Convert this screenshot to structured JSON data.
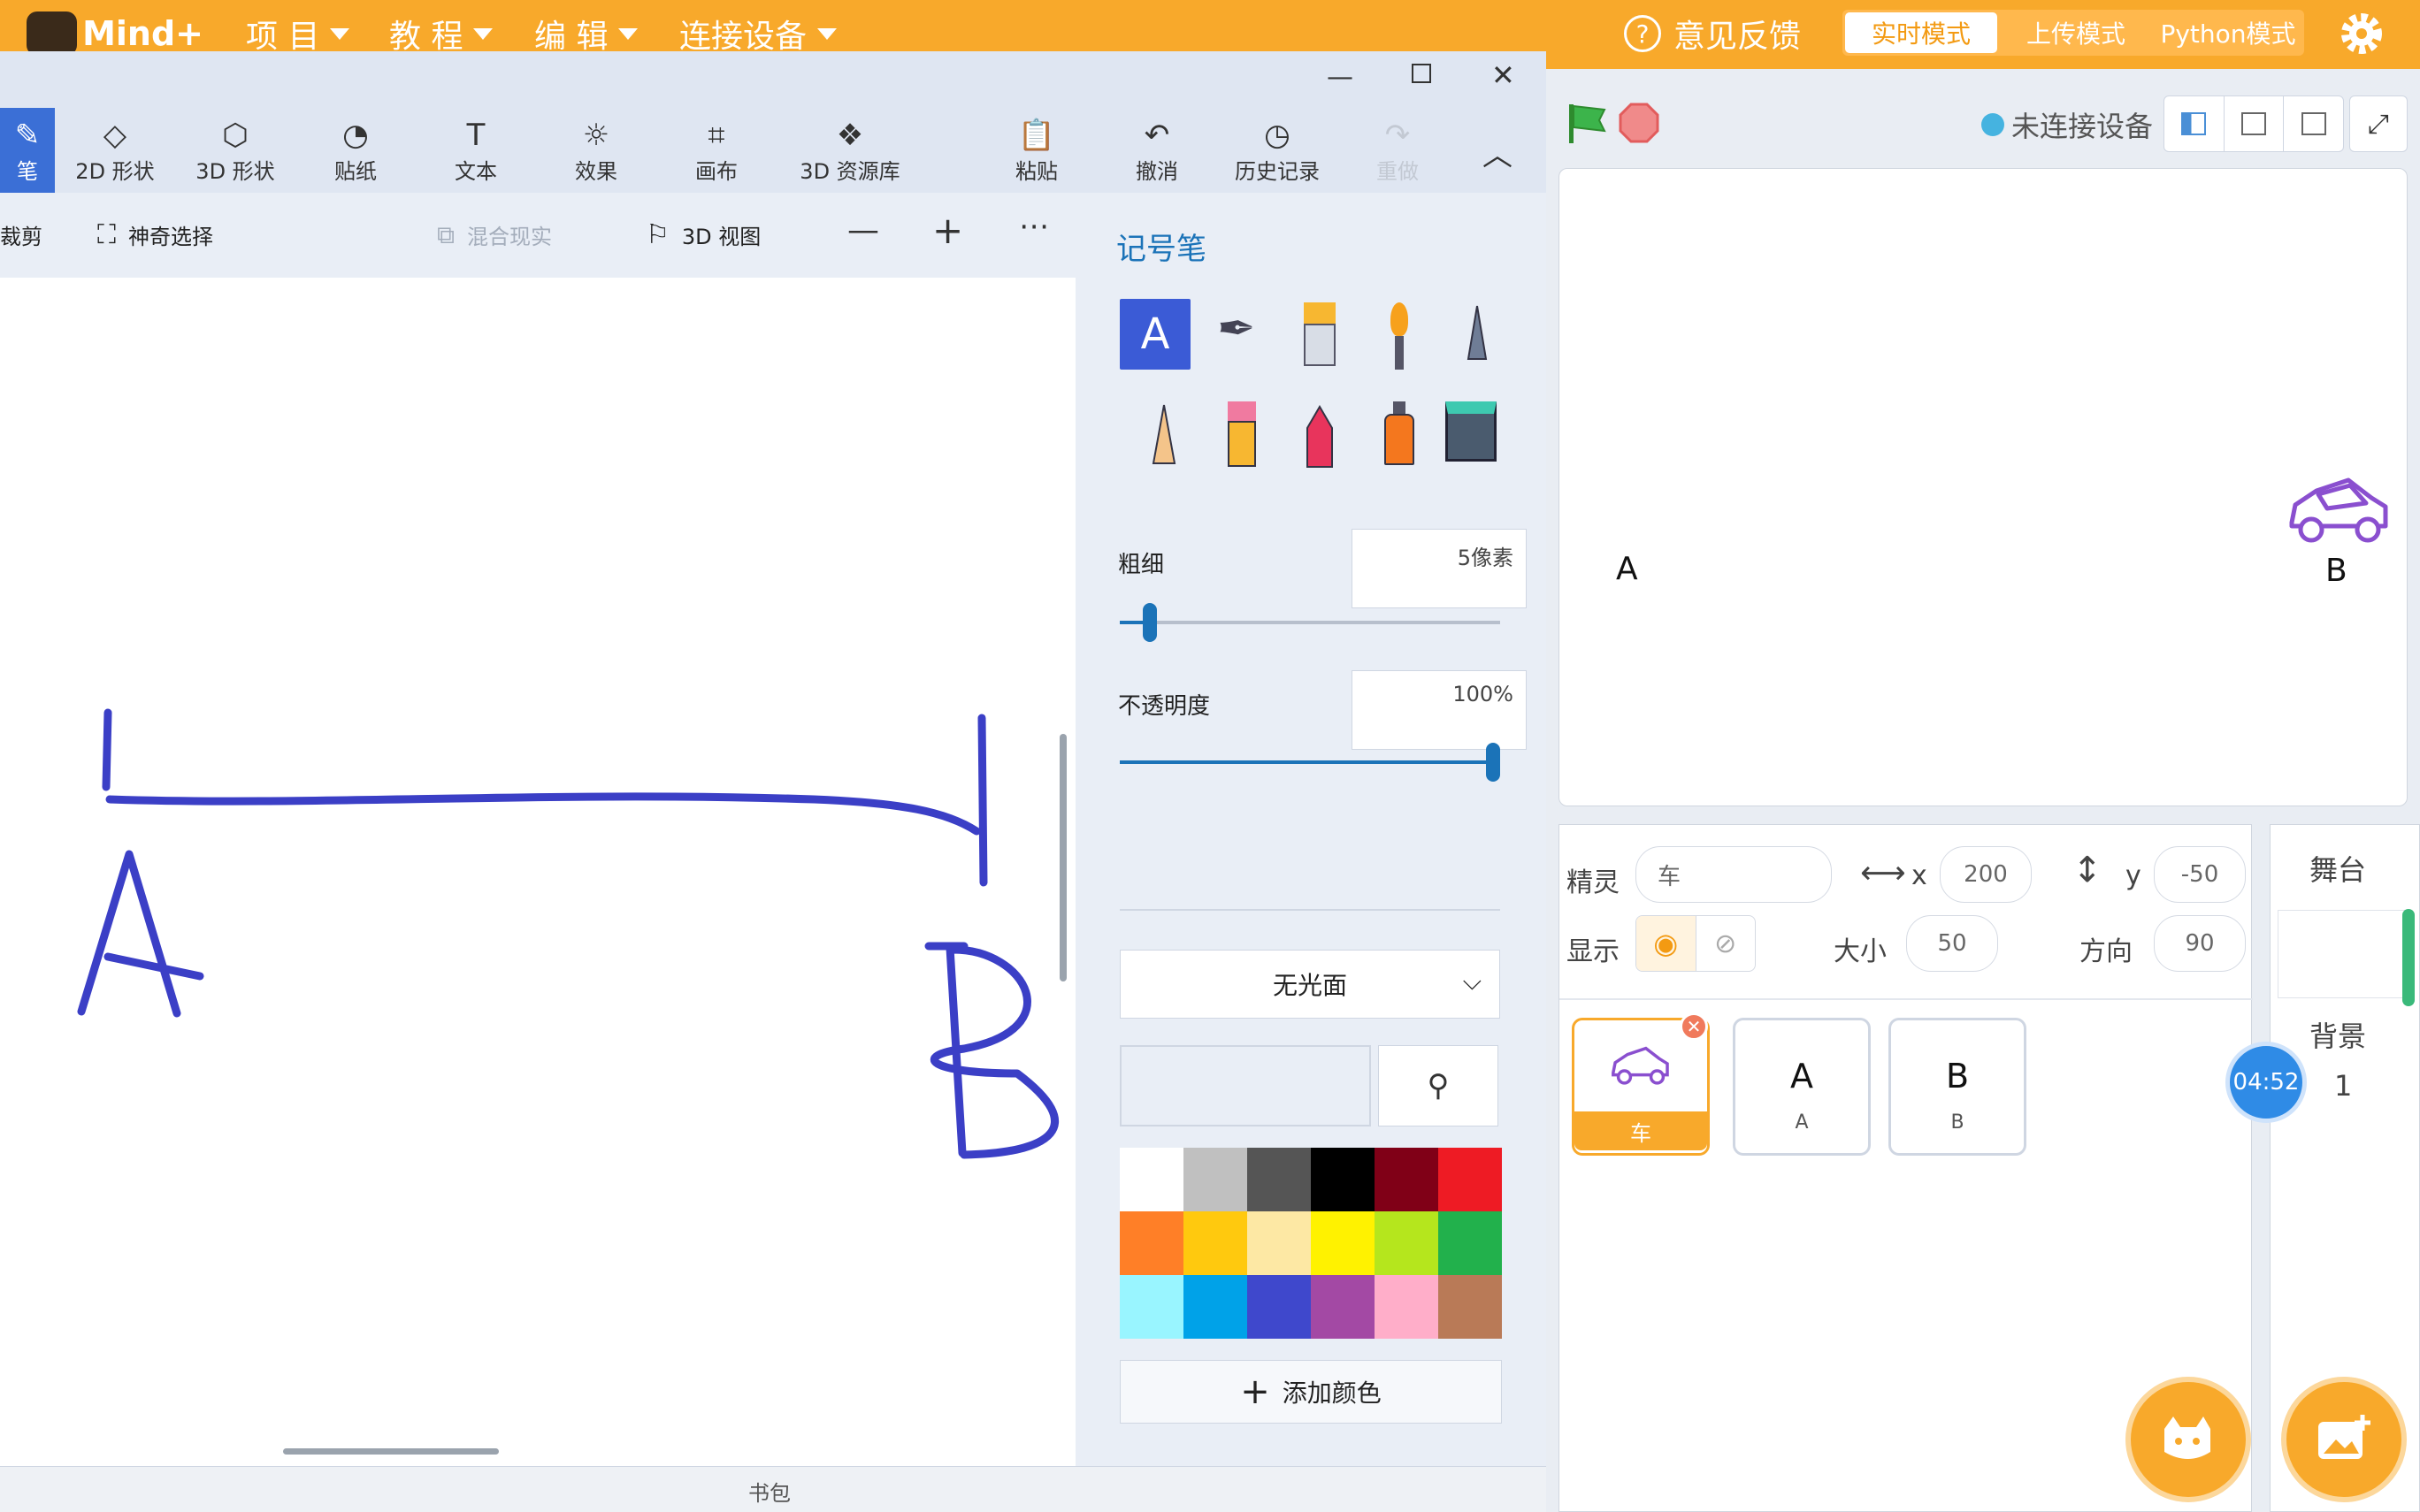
{
  "top": {
    "logo": "Mind+",
    "menus": [
      "项 目",
      "教 程",
      "编 辑",
      "连接设备"
    ],
    "feedback": "意见反馈",
    "modes": [
      "实时模式",
      "上传模式",
      "Python模式"
    ]
  },
  "paint": {
    "ribbon": [
      "笔",
      "2D 形状",
      "3D 形状",
      "贴纸",
      "文本",
      "效果",
      "画布",
      "3D 资源库",
      "粘贴",
      "撤消",
      "历史记录",
      "重做"
    ],
    "subbar": {
      "crop": "裁剪",
      "magic_select": "神奇选择",
      "mixed_reality": "混合现实",
      "view3d": "3D 视图"
    },
    "panel": {
      "title": "记号笔",
      "thickness_label": "粗细",
      "thickness_value": "5像素",
      "thickness_level": 0.06,
      "opacity_label": "不透明度",
      "opacity_value": "100%",
      "opacity_level": 1.0,
      "finish": "无光面",
      "add_color": "添加颜色",
      "palette": [
        "#ffffff",
        "#c0c0c0",
        "#555555",
        "#000000",
        "#800017",
        "#ee1b24",
        "#ff7f27",
        "#ffc90e",
        "#fde8a4",
        "#fff200",
        "#b5e61d",
        "#22b14c",
        "#99f5ff",
        "#00a2e8",
        "#3f48cc",
        "#a349a4",
        "#ffaec9",
        "#b97a57"
      ],
      "stroke_color": "#3b3fc6"
    },
    "canvas": {
      "label_a": "A",
      "label_b": "B"
    },
    "footer": "书包"
  },
  "stage": {
    "device_status": "未连接设备",
    "text_a": "A",
    "text_b": "B"
  },
  "sprite": {
    "sprite_label": "精灵",
    "sprite_name": "车",
    "x_label": "x",
    "x_value": "200",
    "y_label": "y",
    "y_value": "-50",
    "show_label": "显示",
    "size_label": "大小",
    "size_value": "50",
    "direction_label": "方向",
    "direction_value": "90",
    "cards": [
      {
        "title": "",
        "name": "车"
      },
      {
        "title": "A",
        "name": "A"
      },
      {
        "title": "B",
        "name": "B"
      }
    ]
  },
  "stagePanel": {
    "title": "舞台",
    "backdrop_label": "背景",
    "backdrop_count": "1"
  },
  "timer": "04:52",
  "colors": {
    "accent": "#f8a92b",
    "pen": "#3b3fc6"
  }
}
